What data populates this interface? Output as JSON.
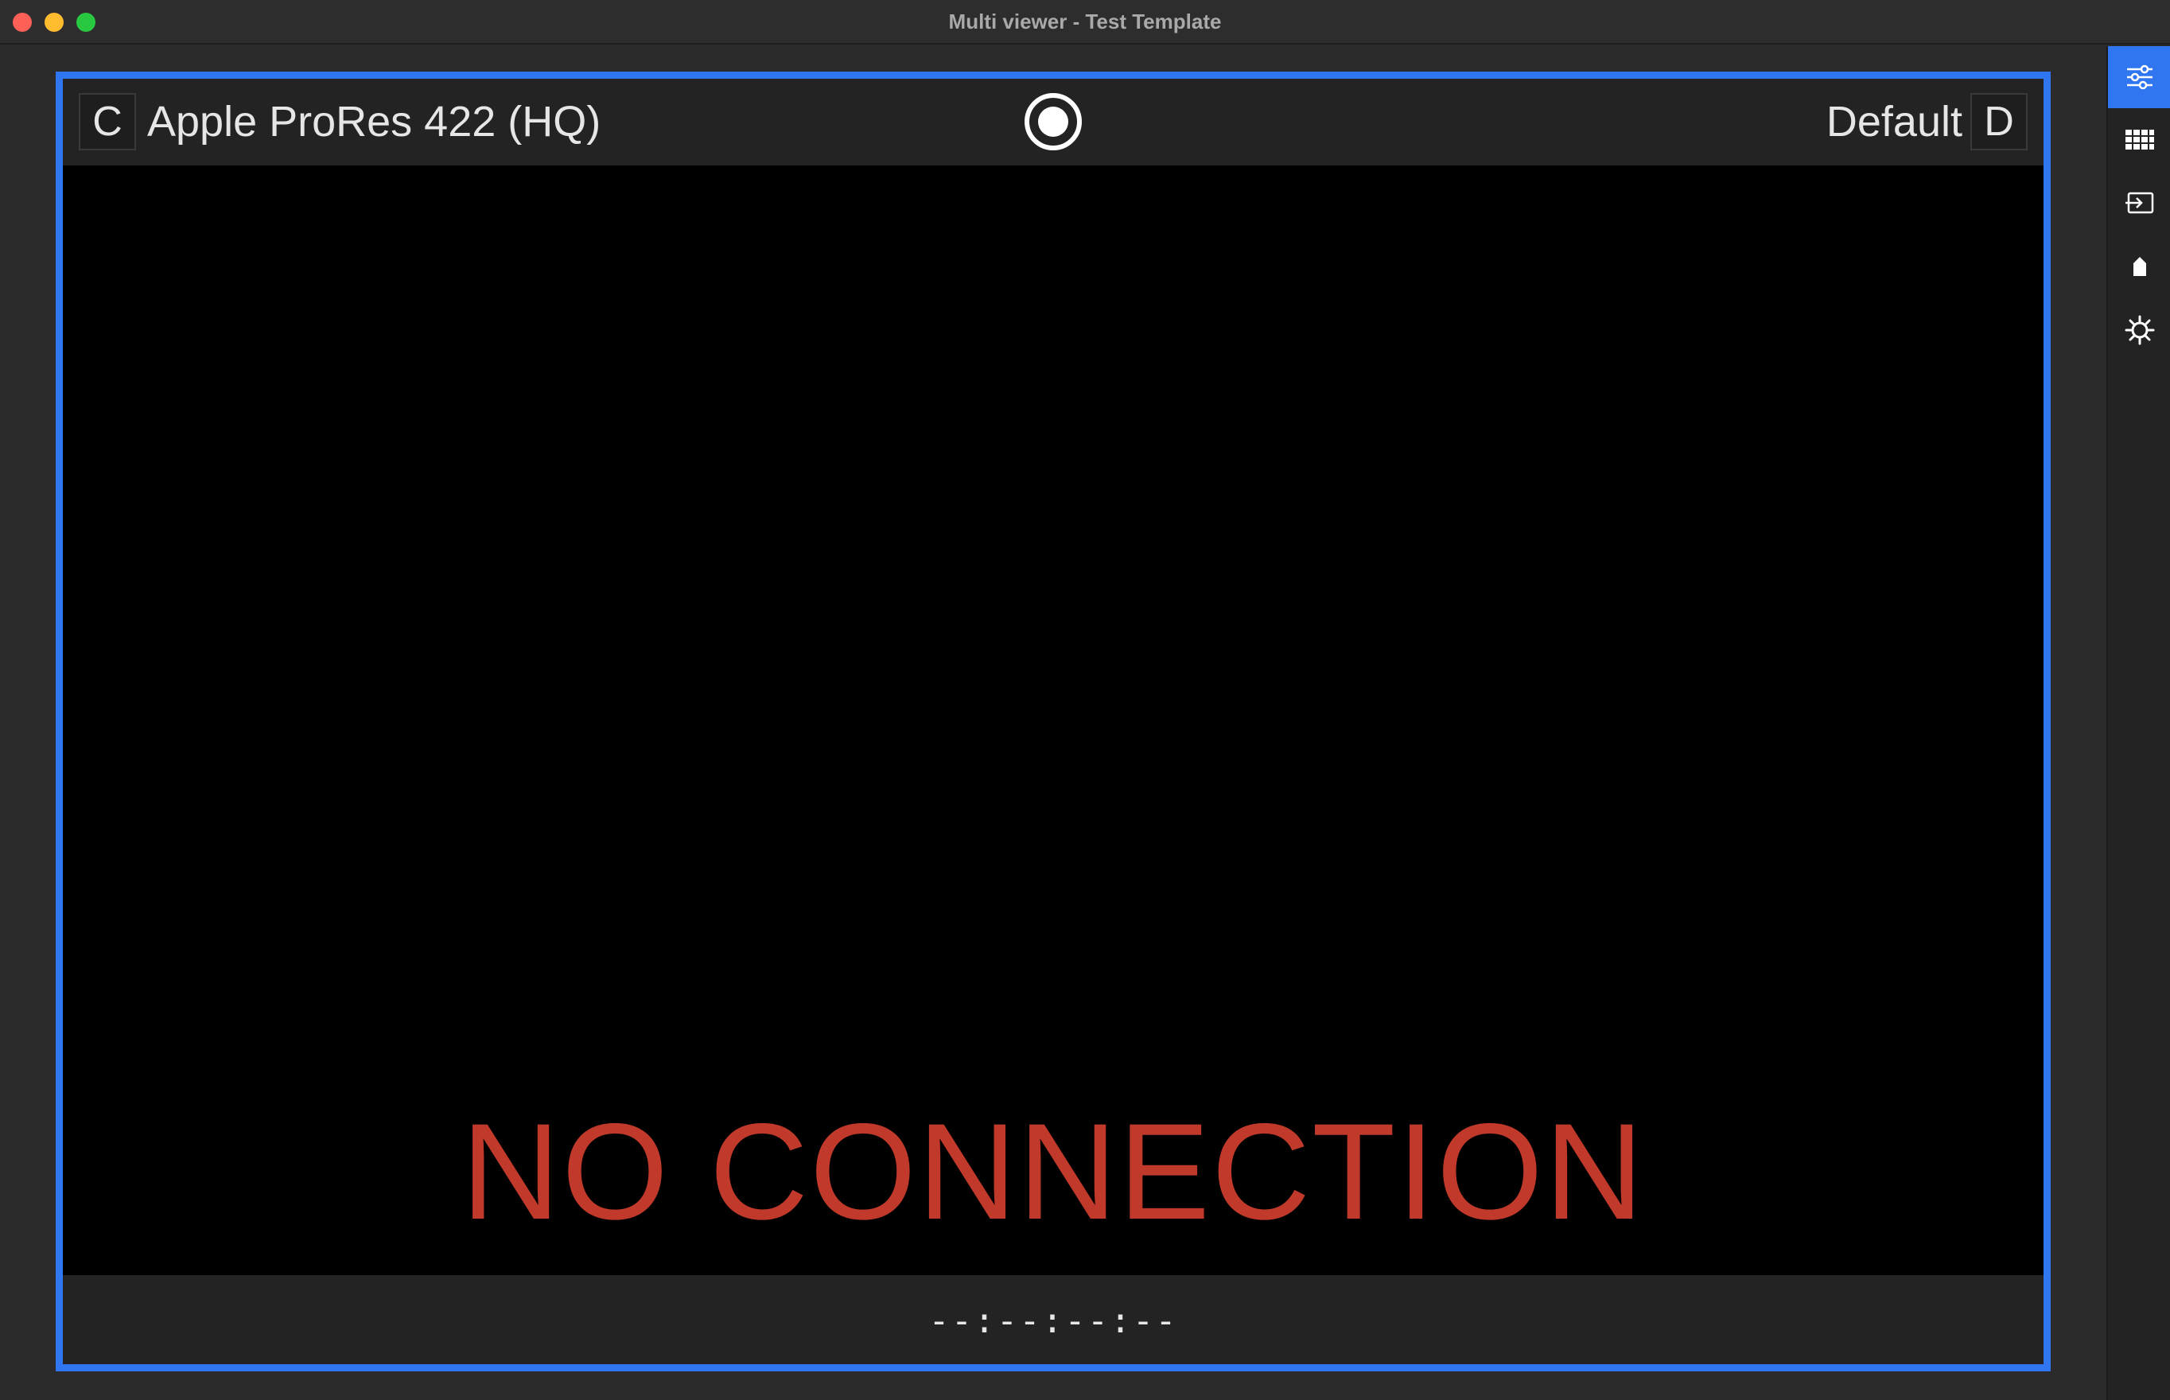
{
  "window": {
    "title": "Multi viewer - Test Template"
  },
  "viewer": {
    "left_channel": "C",
    "codec": "Apple ProRes 422 (HQ)",
    "preset": "Default",
    "right_channel": "D",
    "status": "NO CONNECTION",
    "timecode": "--:--:--:--"
  },
  "colors": {
    "accent": "#2f76f0",
    "status_error": "#c0392b",
    "background": "#2b2b2b",
    "panel": "#232323"
  },
  "sidebar": {
    "items": [
      {
        "name": "adjustments",
        "icon": "sliders-icon",
        "active": true
      },
      {
        "name": "grid",
        "icon": "grid-icon",
        "active": false
      },
      {
        "name": "input",
        "icon": "input-icon",
        "active": false
      },
      {
        "name": "tag",
        "icon": "tag-icon",
        "active": false
      },
      {
        "name": "settings",
        "icon": "gear-icon",
        "active": false
      }
    ]
  }
}
